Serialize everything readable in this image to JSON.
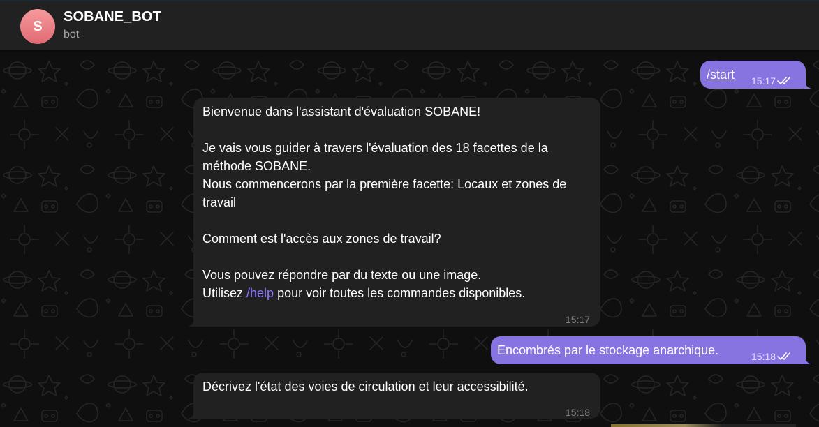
{
  "header": {
    "avatar_letter": "S",
    "title": "SOBANE_BOT",
    "subtitle": "bot"
  },
  "colors": {
    "header_bg": "#212121",
    "incoming_bubble": "#212121",
    "outgoing_bubble": "#8774e1",
    "link": "#8b78ff",
    "avatar": "#f08a8e"
  },
  "messages": [
    {
      "direction": "out",
      "text": "/start",
      "time": "15:17",
      "status": "read"
    },
    {
      "direction": "in",
      "line1": "Bienvenue dans l'assistant d'évaluation SOBANE!",
      "line2": "Je vais vous guider à travers l'évaluation des 18 facettes de la méthode SOBANE.",
      "line3": "Nous commencerons par la première facette: Locaux et zones de travail",
      "line4": "Comment est l'accès aux zones de travail?",
      "line5": "Vous pouvez répondre par du texte ou une image.",
      "line6_prefix": "Utilisez ",
      "line6_link": "/help",
      "line6_suffix": " pour voir toutes les commandes disponibles.",
      "time": "15:17"
    },
    {
      "direction": "out",
      "text": "Encombrés par le stockage anarchique.",
      "time": "15:18",
      "status": "read"
    },
    {
      "direction": "in",
      "text": "Décrivez l'état des voies de circulation et leur accessibilité.",
      "time": "15:18"
    }
  ],
  "icons": [
    "double-check-icon",
    "doodle-background-pattern"
  ]
}
